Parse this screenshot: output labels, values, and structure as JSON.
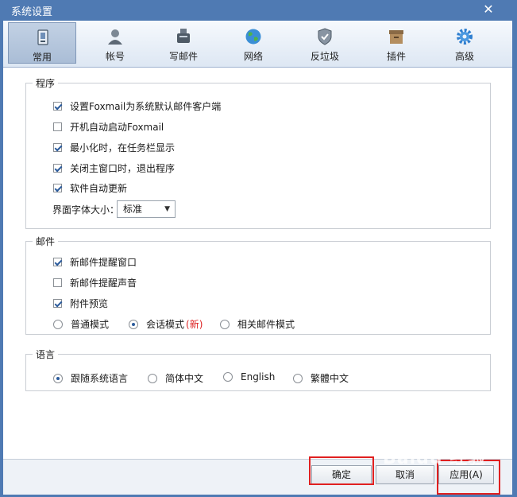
{
  "window": {
    "title": "系统设置"
  },
  "tabs": [
    {
      "label": "常用",
      "icon": "general-settings-icon"
    },
    {
      "label": "帐号",
      "icon": "account-person-icon"
    },
    {
      "label": "写邮件",
      "icon": "compose-mail-icon"
    },
    {
      "label": "网络",
      "icon": "network-globe-icon"
    },
    {
      "label": "反垃圾",
      "icon": "antispam-shield-icon"
    },
    {
      "label": "插件",
      "icon": "plugin-box-icon"
    },
    {
      "label": "高级",
      "icon": "advanced-gear-icon"
    }
  ],
  "active_tab": "常用",
  "program": {
    "title": "程序",
    "options": [
      {
        "label": "设置Foxmail为系统默认邮件客户端",
        "checked": true
      },
      {
        "label": "开机自动启动Foxmail",
        "checked": false
      },
      {
        "label": "最小化时，在任务栏显示",
        "checked": true
      },
      {
        "label": "关闭主窗口时，退出程序",
        "checked": true
      },
      {
        "label": "软件自动更新",
        "checked": true
      }
    ],
    "font_size_label": "界面字体大小：",
    "font_size_value": "标准"
  },
  "mail": {
    "title": "邮件",
    "options": [
      {
        "label": "新邮件提醒窗口",
        "checked": true
      },
      {
        "label": "新邮件提醒声音",
        "checked": false
      },
      {
        "label": "附件预览",
        "checked": true
      }
    ],
    "modes": [
      {
        "label": "普通模式",
        "selected": false
      },
      {
        "label": "会话模式",
        "selected": true,
        "badge": "(新)"
      },
      {
        "label": "相关邮件模式",
        "selected": false
      }
    ]
  },
  "language": {
    "title": "语言",
    "options": [
      {
        "label": "跟随系统语言",
        "selected": true
      },
      {
        "label": "简体中文",
        "selected": false
      },
      {
        "label": "English",
        "selected": false
      },
      {
        "label": "繁體中文",
        "selected": false
      }
    ]
  },
  "buttons": {
    "ok": "确定",
    "cancel": "取消",
    "apply": "应用(A)"
  },
  "watermark": "Baidu 经验",
  "colors": {
    "title_bar": "#4f7ab3",
    "check": "#2b5b9c",
    "highlight": "#e02020",
    "new_badge": "#dd2222"
  }
}
